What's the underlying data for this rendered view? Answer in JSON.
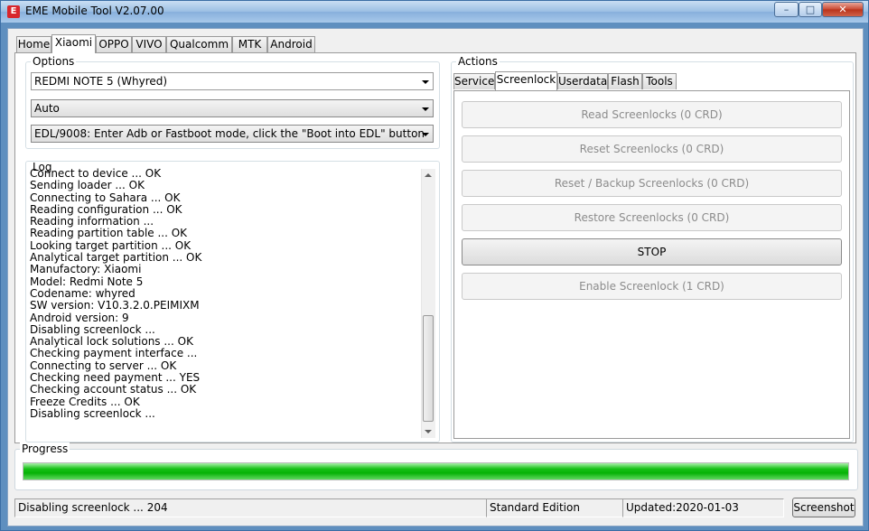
{
  "window": {
    "title": "EME Mobile Tool V2.07.00",
    "icon": "app-logo-icon",
    "controls": {
      "minimize": "–",
      "maximize": "□",
      "close": "✕"
    }
  },
  "main_tabs": [
    "Home",
    "Xiaomi",
    "OPPO",
    "VIVO",
    "Qualcomm",
    "MTK",
    "Android"
  ],
  "main_tab_active": "Xiaomi",
  "options": {
    "label": "Options",
    "model": "REDMI NOTE 5 (Whyred)",
    "mode": "Auto",
    "method": "EDL/9008: Enter Adb or Fastboot mode, click the \"Boot into EDL\" button"
  },
  "log": {
    "label": "Log",
    "lines": [
      "Connect to device ... OK",
      "Sending loader ... OK",
      "Connecting to Sahara ... OK",
      "Reading configuration ... OK",
      "Reading information ...",
      "Reading partition table ... OK",
      "Looking target partition ... OK",
      "Analytical target partition ... OK",
      "Manufactory: Xiaomi",
      "Model: Redmi Note 5",
      "Codename: whyred",
      "SW version: V10.3.2.0.PEIMIXM",
      "Android version: 9",
      "Disabling screenlock ...",
      "Analytical lock solutions ... OK",
      "Checking payment interface ...",
      "Connecting to server ... OK",
      "Checking need payment ... YES",
      "Checking account status ... OK",
      "Freeze Credits ... OK",
      "Disabling screenlock ..."
    ]
  },
  "actions": {
    "label": "Actions",
    "tabs": [
      "Service",
      "Screenlock",
      "Userdata",
      "Flash",
      "Tools"
    ],
    "active_tab": "Screenlock",
    "buttons": [
      {
        "label": "Read Screenlocks (0 CRD)",
        "enabled": false
      },
      {
        "label": "Reset Screenlocks (0 CRD)",
        "enabled": false
      },
      {
        "label": "Reset / Backup Screenlocks (0 CRD)",
        "enabled": false
      },
      {
        "label": "Restore Screenlocks (0 CRD)",
        "enabled": false
      },
      {
        "label": "STOP",
        "enabled": true
      },
      {
        "label": "Enable Screenlock (1 CRD)",
        "enabled": false
      }
    ]
  },
  "progress": {
    "label": "Progress",
    "value_percent": 100,
    "color": "#0fbf0f"
  },
  "status_bar": {
    "message": "Disabling screenlock ... 204",
    "edition": "Standard Edition",
    "updated": "Updated:2020-01-03",
    "screenshot_button": "Screenshot"
  }
}
